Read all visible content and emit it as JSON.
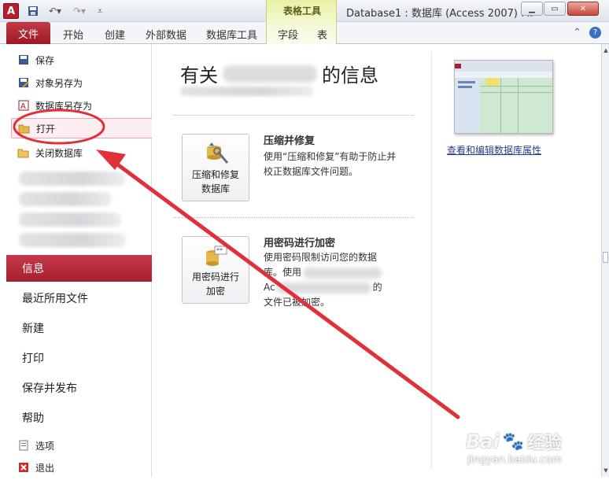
{
  "window": {
    "app_icon": "A",
    "title": "Database1 : 数据库 (Access 2007) M.",
    "context_group": "表格工具"
  },
  "ribbon": {
    "file_tab": "文件",
    "tabs": [
      "开始",
      "创建",
      "外部数据",
      "数据库工具",
      "字段",
      "表"
    ]
  },
  "backstage": {
    "commands": [
      {
        "label": "保存",
        "icon": "save-icon"
      },
      {
        "label": "对象另存为",
        "icon": "save-as-icon"
      },
      {
        "label": "数据库另存为",
        "icon": "database-save-as-icon"
      },
      {
        "label": "打开",
        "icon": "open-folder-icon"
      },
      {
        "label": "关闭数据库",
        "icon": "close-folder-icon"
      }
    ],
    "tabs": [
      "信息",
      "最近所用文件",
      "新建",
      "打印",
      "保存并发布",
      "帮助"
    ],
    "bottom": [
      {
        "label": "选项",
        "icon": "options-icon"
      },
      {
        "label": "退出",
        "icon": "exit-icon"
      }
    ]
  },
  "info": {
    "heading_prefix": "有关",
    "heading_suffix": "的信息",
    "compact": {
      "button_line1": "压缩和修复",
      "button_line2": "数据库",
      "title": "压缩并修复",
      "desc": "使用“压缩和修复”有助于防止并校正数据库文件问题。"
    },
    "encrypt": {
      "button_line1": "用密码进行",
      "button_line2": "加密",
      "title": "用密码进行加密",
      "desc_line1": "使用密码限制访问您的数据",
      "desc_line2": "库。使用",
      "desc_line3a": "Ac",
      "desc_line3b": "的",
      "desc_line4": "文件已被加密。"
    },
    "properties_link": "查看和编辑数据库属性"
  },
  "colors": {
    "file_red": "#a5202f",
    "annotation_red": "#e0303a",
    "context_yellow": "#e9f2a3",
    "link_blue": "#2a3d8f"
  },
  "watermark": {
    "brand": "Bai",
    "brand2": "经验",
    "url": "jingyan.baidu.com"
  }
}
